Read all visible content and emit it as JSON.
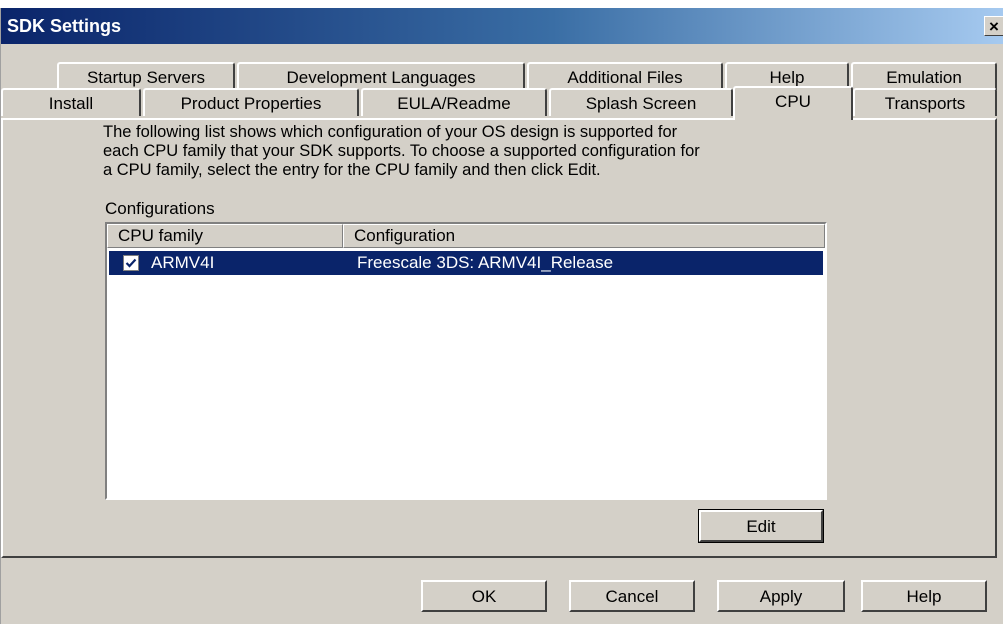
{
  "window": {
    "title": "SDK Settings",
    "close_glyph": "×"
  },
  "tabs": {
    "row1": [
      "Startup Servers",
      "Development Languages",
      "Additional Files",
      "Help",
      "Emulation"
    ],
    "row2": [
      "Install",
      "Product Properties",
      "EULA/Readme",
      "Splash Screen",
      "CPU",
      "Transports"
    ],
    "selected": "CPU"
  },
  "cpu_tab": {
    "description_lines": [
      "The following list shows which configuration of your OS design is supported for",
      "each CPU family that your SDK supports. To choose a supported configuration for",
      "a CPU family, select the entry for the CPU family and then click Edit."
    ],
    "group_label": "Configurations",
    "columns": [
      "CPU family",
      "Configuration"
    ],
    "rows": [
      {
        "checked": true,
        "cpu_family": "ARMV4I",
        "configuration": "Freescale 3DS: ARMV4I_Release",
        "selected": true
      }
    ],
    "edit_label": "Edit"
  },
  "footer": {
    "ok_label": "OK",
    "cancel_label": "Cancel",
    "apply_label": "Apply",
    "help_label": "Help"
  },
  "colors": {
    "dialog_face": "#d4d0c8",
    "title_gradient_start": "#0a246a",
    "selection": "#0a246a"
  }
}
